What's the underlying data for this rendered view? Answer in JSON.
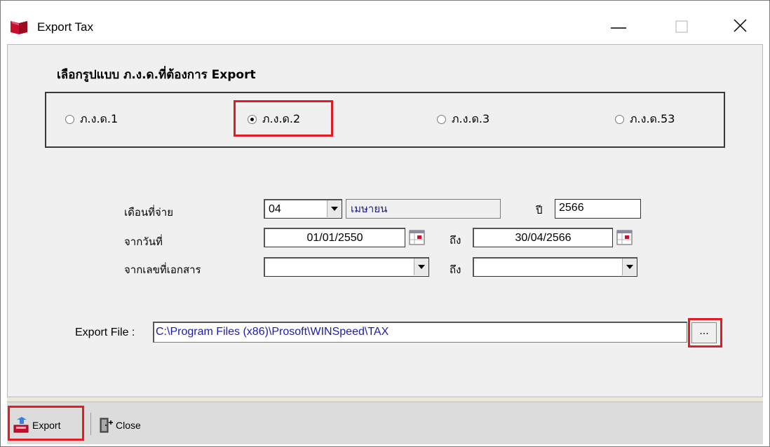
{
  "window": {
    "title": "Export Tax",
    "minimize_glyph": "—",
    "close_glyph": "✕"
  },
  "form_type": {
    "label": "เลือกรูปแบบ ภ.ง.ด.ที่ต้องการ Export",
    "options": [
      {
        "label": "ภ.ง.ด.1",
        "checked": false
      },
      {
        "label": "ภ.ง.ด.2",
        "checked": true
      },
      {
        "label": "ภ.ง.ด.3",
        "checked": false
      },
      {
        "label": "ภ.ง.ด.53",
        "checked": false
      }
    ]
  },
  "filters": {
    "month_label": "เดือนที่จ่าย",
    "month_value": "04",
    "month_name": "เมษายน",
    "year_label": "ปี",
    "year_value": "2566",
    "from_date_label": "จากวันที่",
    "from_date_value": "01/01/2550",
    "to_label": "ถึง",
    "to_date_value": "30/04/2566",
    "doc_label": "จากเลขที่เอกสาร",
    "doc_from_value": "",
    "doc_to_value": ""
  },
  "export_file": {
    "label": "Export File :",
    "path": "C:\\Program Files (x86)\\Prosoft\\WINSpeed\\TAX",
    "browse_label": "..."
  },
  "toolbar": {
    "export_label": "Export",
    "close_label": "Close"
  },
  "colors": {
    "highlight": "#e31b23",
    "app_icon": "#c8102e",
    "path_text": "#1c1cb0"
  }
}
